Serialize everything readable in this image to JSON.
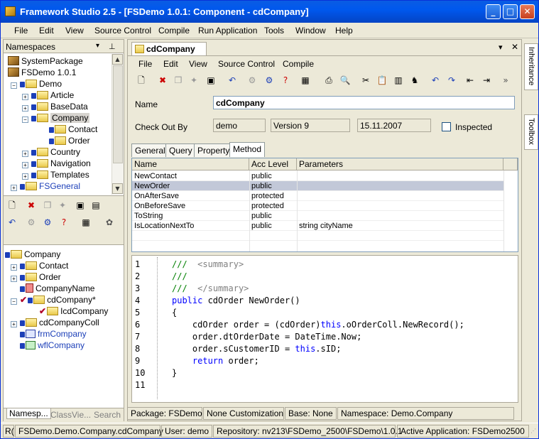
{
  "window": {
    "title": "Framework Studio 2.5 - [FSDemo 1.0.1: Component - cdCompany]"
  },
  "menu": [
    "File",
    "Edit",
    "View",
    "Source Control",
    "Compile",
    "Run Application",
    "Tools",
    "Window",
    "Help"
  ],
  "left": {
    "header": "Namespaces",
    "pin": "ᵖ",
    "tree1": [
      {
        "label": "SystemPackage"
      },
      {
        "label": "FSDemo 1.0.1"
      },
      {
        "label": "Demo"
      },
      {
        "label": "Article"
      },
      {
        "label": "BaseData"
      },
      {
        "label": "Company"
      },
      {
        "label": "Contact"
      },
      {
        "label": "Order"
      },
      {
        "label": "Country"
      },
      {
        "label": "Navigation"
      },
      {
        "label": "Templates"
      },
      {
        "label": "FSGeneral"
      }
    ],
    "tree2": [
      {
        "label": "Company"
      },
      {
        "label": "Contact"
      },
      {
        "label": "Order"
      },
      {
        "label": "CompanyName"
      },
      {
        "label": "cdCompany*"
      },
      {
        "label": "IcdCompany"
      },
      {
        "label": "cdCompanyColl"
      },
      {
        "label": "frmCompany"
      },
      {
        "label": "wflCompany"
      }
    ],
    "tabs": [
      "Namesp...",
      "ClassVie...",
      "Search"
    ]
  },
  "doc": {
    "tab": "cdCompany",
    "menu": [
      "File",
      "Edit",
      "View",
      "Source Control",
      "Compile"
    ],
    "name_label": "Name",
    "name_value": "cdCompany",
    "checkout_label": "Check Out By",
    "checkout_value": "demo",
    "version_value": "Version 9",
    "date_value": "15.11.2007",
    "inspected_label": "Inspected",
    "tabs": [
      "General",
      "Query",
      "Property",
      "Method"
    ],
    "grid": {
      "headers": [
        "Name",
        "Acc Level",
        "Parameters"
      ],
      "rows": [
        {
          "name": "NewContact",
          "acc": "public",
          "params": ""
        },
        {
          "name": "NewOrder",
          "acc": "public",
          "params": ""
        },
        {
          "name": "OnAfterSave",
          "acc": "protected",
          "params": ""
        },
        {
          "name": "OnBeforeSave",
          "acc": "protected",
          "params": ""
        },
        {
          "name": "ToString",
          "acc": "public",
          "params": ""
        },
        {
          "name": "IsLocationNextTo",
          "acc": "public",
          "params": "string cityName"
        }
      ]
    },
    "code_lines": [
      "1",
      "2",
      "3",
      "4",
      "5",
      "6",
      "7",
      "8",
      "9",
      "10",
      "11"
    ],
    "status": [
      "Package: FSDemo",
      "None Customization",
      "Base: None",
      "Namespace: Demo.Company"
    ]
  },
  "sidebar": [
    "Inheritance",
    "Toolbox"
  ],
  "bottom": [
    "R(",
    "FSDemo.Demo.Company.cdCompany",
    "User: demo",
    "Repository: nv213\\FSDemo_2500\\FSDemo\\1.0.1",
    "Active Application: FSDemo2500"
  ]
}
